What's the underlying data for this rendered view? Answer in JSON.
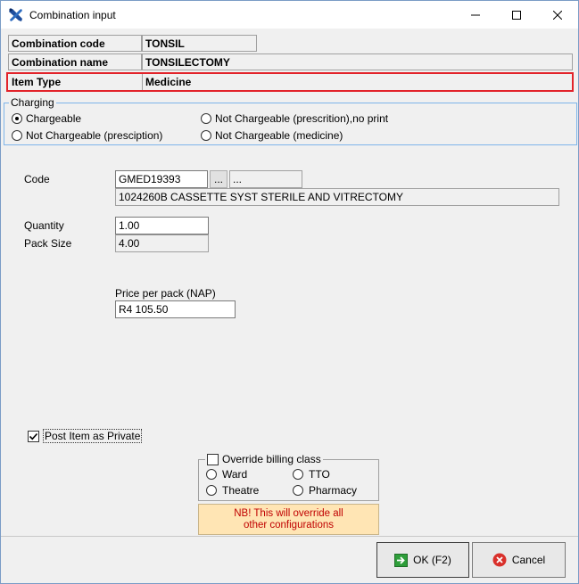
{
  "window": {
    "title": "Combination input"
  },
  "fields": {
    "combination_code": {
      "label": "Combination code",
      "value": "TONSIL"
    },
    "combination_name": {
      "label": "Combination name",
      "value": "TONSILECTOMY"
    },
    "item_type": {
      "label": "Item Type",
      "value": "Medicine"
    }
  },
  "charging": {
    "title": "Charging",
    "options": [
      {
        "label": "Chargeable",
        "selected": true
      },
      {
        "label": "Not Chargeable (presciption)",
        "selected": false
      },
      {
        "label": "Not Chargeable (prescrition),no print",
        "selected": false
      },
      {
        "label": "Not Chargeable (medicine)",
        "selected": false
      }
    ]
  },
  "item": {
    "code_label": "Code",
    "code_value": "GMED19393",
    "browse_label": "...",
    "extra_value": "...",
    "description": "1024260B CASSETTE SYST STERILE AND VITRECTOMY",
    "quantity_label": "Quantity",
    "quantity_value": "1.00",
    "pack_size_label": "Pack Size",
    "pack_size_value": "4.00",
    "price_label": "Price per pack (NAP)",
    "price_value": "R4 105.50"
  },
  "post_private": {
    "label": "Post Item as Private",
    "checked": true
  },
  "override": {
    "label": "Override billing class",
    "checked": false,
    "options": [
      "Ward",
      "TTO",
      "Theatre",
      "Pharmacy"
    ]
  },
  "note": {
    "line1": "NB! This will override all",
    "line2": "other configurations"
  },
  "buttons": {
    "ok": "OK (F2)",
    "cancel": "Cancel"
  },
  "colors": {
    "highlight": "#e2232a",
    "note_bg": "#ffe5b4",
    "note_text": "#c00000",
    "group_border": "#7eb4ea"
  }
}
